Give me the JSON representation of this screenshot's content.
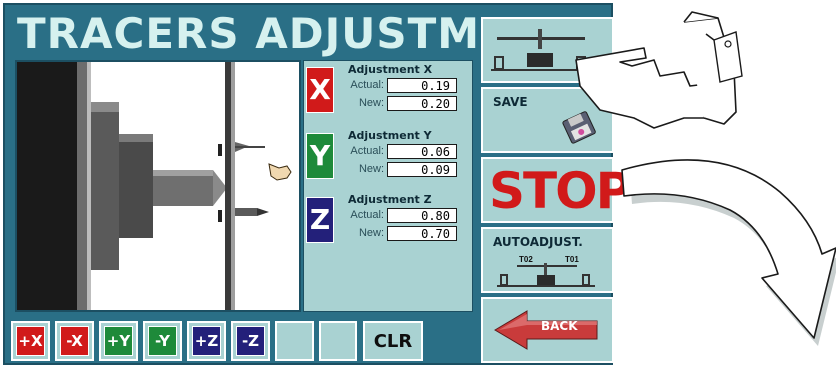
{
  "screen": {
    "title": "TRACERS ADJUSTMENT"
  },
  "adjustments": [
    {
      "axis": "X",
      "title": "Adjustment X",
      "actual_label": "Actual:",
      "actual": "0.19",
      "new_label": "New:",
      "new": "0.20",
      "color": "#d11a1a"
    },
    {
      "axis": "Y",
      "title": "Adjustment Y",
      "actual_label": "Actual:",
      "actual": "0.06",
      "new_label": "New:",
      "new": "0.09",
      "color": "#1e8a3a"
    },
    {
      "axis": "Z",
      "title": "Adjustment Z",
      "actual_label": "Actual:",
      "actual": "0.80",
      "new_label": "New:",
      "new": "0.70",
      "color": "#23207a"
    }
  ],
  "right_buttons": {
    "save_label": "SAVE",
    "stop_label": "STOP",
    "autoadjust_label": "AUTOADJUST.",
    "t02_label": "T02",
    "t01_label": "T01",
    "back_label": "BACK"
  },
  "bottom_buttons": [
    {
      "label": "+X",
      "color": "#d11a1a",
      "icon": "plus-x"
    },
    {
      "label": "-X",
      "color": "#d11a1a",
      "icon": "minus-x"
    },
    {
      "label": "+Y",
      "color": "#1e8a3a",
      "icon": "plus-y"
    },
    {
      "label": "-Y",
      "color": "#1e8a3a",
      "icon": "minus-y"
    },
    {
      "label": "+Z",
      "color": "#23207a",
      "icon": "plus-z"
    },
    {
      "label": "-Z",
      "color": "#23207a",
      "icon": "minus-z"
    }
  ],
  "clear_label": "CLR",
  "colors": {
    "panel": "#2a6f86",
    "button_face": "#a9d2d2",
    "stop_red": "#d11a1a",
    "back_arrow": "#c93b3b"
  }
}
